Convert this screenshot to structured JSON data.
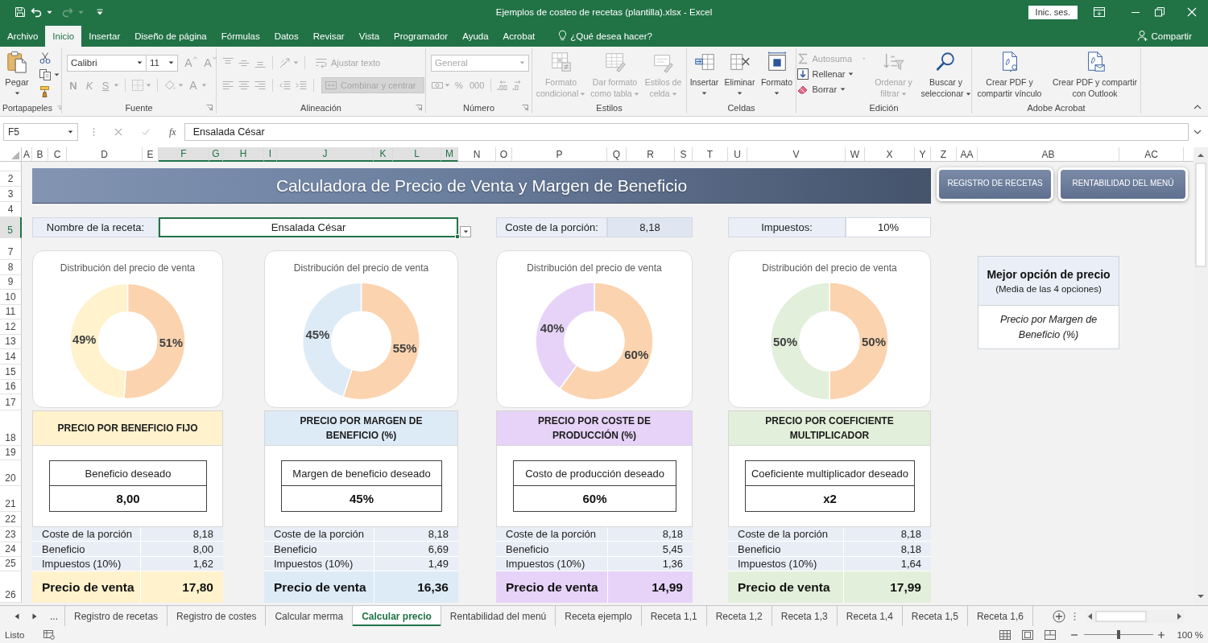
{
  "window": {
    "title": "Ejemplos de costeo de recetas (plantilla).xlsx - Excel",
    "sign_in": "Inic. ses."
  },
  "menu": {
    "tabs": [
      {
        "label": "Archivo",
        "selected": false
      },
      {
        "label": "Inicio",
        "selected": true
      },
      {
        "label": "Insertar",
        "selected": false
      },
      {
        "label": "Diseño de página",
        "selected": false
      },
      {
        "label": "Fórmulas",
        "selected": false
      },
      {
        "label": "Datos",
        "selected": false
      },
      {
        "label": "Revisar",
        "selected": false
      },
      {
        "label": "Vista",
        "selected": false
      },
      {
        "label": "Programador",
        "selected": false
      },
      {
        "label": "Ayuda",
        "selected": false
      },
      {
        "label": "Acrobat",
        "selected": false
      }
    ],
    "tell_me": "¿Qué desea hacer?",
    "share": "Compartir"
  },
  "ribbon": {
    "groups": [
      {
        "label": "Portapapeles",
        "dialog_launcher": true,
        "controls": [
          {
            "label": "Pegar",
            "disabled": false
          }
        ]
      },
      {
        "label": "Fuente",
        "dialog_launcher": true,
        "font_name": {
          "value": "Calibri"
        },
        "font_size": {
          "value": "11"
        },
        "controls": [
          {
            "kind": "grow",
            "label": "A",
            "disabled": true
          },
          {
            "kind": "shrink",
            "label": "A",
            "disabled": true
          },
          {
            "kind": "bold",
            "label": "N",
            "disabled": true
          },
          {
            "kind": "italic",
            "label": "K",
            "disabled": true
          },
          {
            "kind": "underline",
            "label": "S",
            "disabled": true
          },
          {
            "kind": "color",
            "label": "A",
            "disabled": true
          }
        ]
      },
      {
        "label": "Alineación",
        "dialog_launcher": true,
        "controls": [
          {
            "label": "Ajustar texto",
            "disabled": true,
            "pressed": false
          },
          {
            "label": "Combinar y centrar",
            "disabled": true,
            "pressed": true
          }
        ]
      },
      {
        "label": "Número",
        "dialog_launcher": true,
        "format": {
          "value": "General",
          "disabled": true
        },
        "controls": [
          {
            "label": "%",
            "disabled": true
          },
          {
            "label": "000",
            "disabled": true
          }
        ]
      },
      {
        "label": "Estilos",
        "dialog_launcher": false,
        "controls": [
          {
            "label": "Formato condicional",
            "disabled": true
          },
          {
            "label": "Dar formato como tabla",
            "disabled": true
          },
          {
            "label": "Estilos de celda",
            "disabled": true
          }
        ]
      },
      {
        "label": "Celdas",
        "dialog_launcher": false,
        "controls": [
          {
            "label": "Insertar",
            "disabled": false
          },
          {
            "label": "Eliminar",
            "disabled": false
          },
          {
            "label": "Formato",
            "disabled": false
          }
        ]
      },
      {
        "label": "Edición",
        "dialog_launcher": false,
        "controls": [
          {
            "label": "Autosuma",
            "disabled": true
          },
          {
            "label": "Rellenar",
            "disabled": false
          },
          {
            "label": "Borrar",
            "disabled": false
          },
          {
            "label": "Ordenar y filtrar",
            "disabled": true
          },
          {
            "label": "Buscar y seleccionar",
            "disabled": false
          }
        ]
      },
      {
        "label": "Adobe Acrobat",
        "dialog_launcher": false,
        "controls": [
          {
            "label": "Crear PDF y compartir vínculo",
            "disabled": false
          },
          {
            "label": "Crear PDF y compartir con Outlook",
            "disabled": false
          }
        ]
      }
    ]
  },
  "formula_bar": {
    "name_box": "F5",
    "function_button": "fx",
    "formula": "Ensalada César"
  },
  "sheet": {
    "columns": [
      {
        "label": "A",
        "selected": false
      },
      {
        "label": "B",
        "selected": false
      },
      {
        "label": "C",
        "selected": false
      },
      {
        "label": "D",
        "selected": false
      },
      {
        "label": "E",
        "selected": false
      },
      {
        "label": "F",
        "selected": true
      },
      {
        "label": "G",
        "selected": true
      },
      {
        "label": "H",
        "selected": true
      },
      {
        "label": "I",
        "selected": true
      },
      {
        "label": "J",
        "selected": true
      },
      {
        "label": "K",
        "selected": true
      },
      {
        "label": "L",
        "selected": true
      },
      {
        "label": "M",
        "selected": true
      },
      {
        "label": "N",
        "selected": false
      },
      {
        "label": "O",
        "selected": false
      },
      {
        "label": "P",
        "selected": false
      },
      {
        "label": "Q",
        "selected": false
      },
      {
        "label": "R",
        "selected": false
      },
      {
        "label": "S",
        "selected": false
      },
      {
        "label": "T",
        "selected": false
      },
      {
        "label": "U",
        "selected": false
      },
      {
        "label": "V",
        "selected": false
      },
      {
        "label": "W",
        "selected": false
      },
      {
        "label": "X",
        "selected": false
      },
      {
        "label": "Y",
        "selected": false
      },
      {
        "label": "Z",
        "selected": false
      },
      {
        "label": "AA",
        "selected": false
      },
      {
        "label": "AB",
        "selected": false
      },
      {
        "label": "AC",
        "selected": false
      }
    ],
    "rows": [
      {
        "label": "2",
        "selected": false
      },
      {
        "label": "3",
        "selected": false
      },
      {
        "label": "4",
        "selected": false
      },
      {
        "label": "5",
        "selected": true
      },
      {
        "label": "7",
        "selected": false
      },
      {
        "label": "8",
        "selected": false
      },
      {
        "label": "9",
        "selected": false
      },
      {
        "label": "10",
        "selected": false
      },
      {
        "label": "11",
        "selected": false
      },
      {
        "label": "12",
        "selected": false
      },
      {
        "label": "13",
        "selected": false
      },
      {
        "label": "14",
        "selected": false
      },
      {
        "label": "15",
        "selected": false
      },
      {
        "label": "16",
        "selected": false
      },
      {
        "label": "17",
        "selected": false
      },
      {
        "label": "18",
        "selected": false
      },
      {
        "label": "19",
        "selected": false
      },
      {
        "label": "20",
        "selected": false
      },
      {
        "label": "21",
        "selected": false
      },
      {
        "label": "22",
        "selected": false
      },
      {
        "label": "23",
        "selected": false
      },
      {
        "label": "24",
        "selected": false
      },
      {
        "label": "25",
        "selected": false
      },
      {
        "label": "26",
        "selected": false
      }
    ],
    "title": "Calculadora de Precio de Venta y Margen de Beneficio",
    "nav_buttons": [
      "REGISTRO DE RECETAS",
      "RENTABILIDAD DEL MENÚ"
    ],
    "fields": [
      {
        "kind": "dropdown",
        "label": "Nombre de la receta:",
        "value": "Ensalada César",
        "selected": true
      },
      {
        "kind": "computed",
        "label": "Coste de la porción:",
        "value": "8,18",
        "selected": false
      },
      {
        "kind": "input",
        "label": "Impuestos:",
        "value": "10%",
        "selected": false
      }
    ],
    "cards": [
      {
        "color": "#fff2cc",
        "chart_data": {
          "type": "donut",
          "title": "Distribución del precio de venta",
          "values": [
            51,
            49
          ],
          "data_labels": true,
          "value_labels": [
            "51%",
            "49%"
          ]
        },
        "heading": "PRECIO POR BENEFICIO FIJO",
        "target": {
          "label": "Beneficio deseado",
          "value": "8,00"
        },
        "rows": [
          {
            "label": "Coste de la porción",
            "value": "8,18"
          },
          {
            "label": "Beneficio",
            "value": "8,00"
          },
          {
            "label": "Impuestos (10%)",
            "value": "1,62"
          }
        ],
        "total": {
          "label": "Precio de venta",
          "value": "17,80"
        }
      },
      {
        "color": "#ddebf7",
        "chart_data": {
          "type": "donut",
          "title": "Distribución del precio de venta",
          "values": [
            55,
            45
          ],
          "data_labels": true,
          "value_labels": [
            "55%",
            "45%"
          ]
        },
        "heading": "PRECIO POR MARGEN DE BENEFICIO (%)",
        "target": {
          "label": "Margen de beneficio deseado",
          "value": "45%"
        },
        "rows": [
          {
            "label": "Coste de la porción",
            "value": "8,18"
          },
          {
            "label": "Beneficio",
            "value": "6,69"
          },
          {
            "label": "Impuestos (10%)",
            "value": "1,49"
          }
        ],
        "total": {
          "label": "Precio de venta",
          "value": "16,36"
        }
      },
      {
        "color": "#e6d3f7",
        "chart_data": {
          "type": "donut",
          "title": "Distribución del precio de venta",
          "values": [
            60,
            40
          ],
          "data_labels": true,
          "value_labels": [
            "60%",
            "40%"
          ]
        },
        "heading": "PRECIO POR COSTE DE PRODUCCIÓN (%)",
        "target": {
          "label": "Costo de producción deseado",
          "value": "60%"
        },
        "rows": [
          {
            "label": "Coste de la porción",
            "value": "8,18"
          },
          {
            "label": "Beneficio",
            "value": "5,45"
          },
          {
            "label": "Impuestos (10%)",
            "value": "1,36"
          }
        ],
        "total": {
          "label": "Precio de venta",
          "value": "14,99"
        }
      },
      {
        "color": "#e2efda",
        "chart_data": {
          "type": "donut",
          "title": "Distribución del precio de venta",
          "values": [
            50,
            50
          ],
          "data_labels": true,
          "value_labels": [
            "50%",
            "50%"
          ]
        },
        "heading": "PRECIO POR COEFICIENTE MULTIPLICADOR",
        "target": {
          "label": "Coeficiente multiplicador deseado",
          "value": "x2"
        },
        "rows": [
          {
            "label": "Coste de la porción",
            "value": "8,18"
          },
          {
            "label": "Beneficio",
            "value": "8,18"
          },
          {
            "label": "Impuestos (10%)",
            "value": "1,64"
          }
        ],
        "total": {
          "label": "Precio de venta",
          "value": "17,99"
        }
      }
    ],
    "best_option": {
      "title": "Mejor opción de precio",
      "subtitle": "(Media de las 4 opciones)",
      "value": "Precio por Margen de Beneficio (%)"
    }
  },
  "sheet_tabs": {
    "overflow": "...",
    "tabs": [
      {
        "label": "Registro de recetas",
        "selected": false
      },
      {
        "label": "Registro de costes",
        "selected": false
      },
      {
        "label": "Calcular merma",
        "selected": false
      },
      {
        "label": "Calcular precio",
        "selected": true
      },
      {
        "label": "Rentabilidad del menú",
        "selected": false
      },
      {
        "label": "Receta ejemplo",
        "selected": false
      },
      {
        "label": "Receta 1,1",
        "selected": false
      },
      {
        "label": "Receta 1,2",
        "selected": false
      },
      {
        "label": "Receta 1,3",
        "selected": false
      },
      {
        "label": "Receta 1,4",
        "selected": false
      },
      {
        "label": "Receta 1,5",
        "selected": false
      },
      {
        "label": "Receta 1,6",
        "selected": false
      }
    ]
  },
  "status_bar": {
    "status": "Listo",
    "zoom": "100 %",
    "zoom_slider": {
      "level": 0.5
    }
  }
}
